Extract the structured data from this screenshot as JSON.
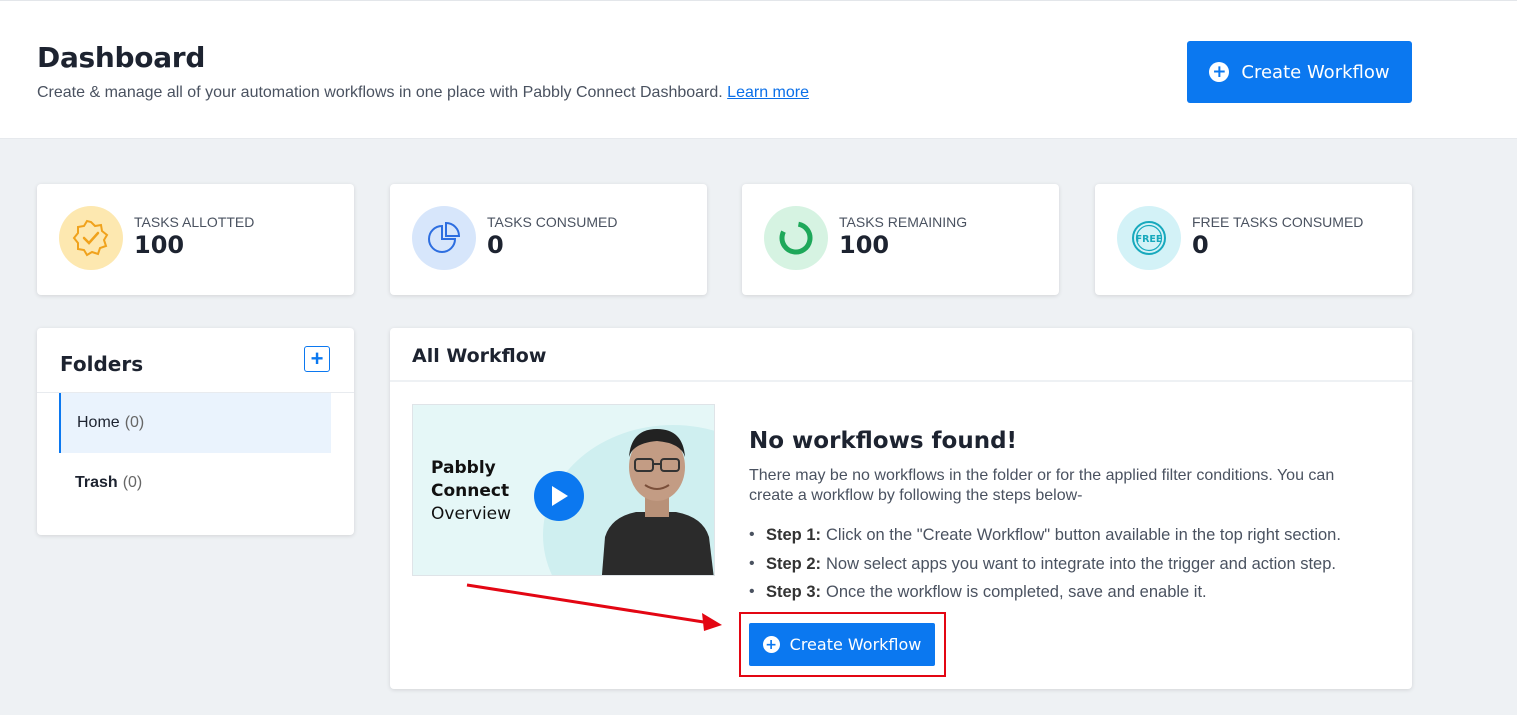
{
  "header": {
    "title": "Dashboard",
    "subtitle": "Create & manage all of your automation workflows in one place with Pabbly Connect Dashboard.",
    "learn_more": "Learn more",
    "create_button": "Create Workflow"
  },
  "stats": [
    {
      "label": "TASKS ALLOTTED",
      "value": "100",
      "icon": "badge-check-icon",
      "color": "#fde8b0"
    },
    {
      "label": "TASKS CONSUMED",
      "value": "0",
      "icon": "pie-chart-icon",
      "color": "#d7e6fb"
    },
    {
      "label": "TASKS REMAINING",
      "value": "100",
      "icon": "progress-ring-icon",
      "color": "#d6f3e2"
    },
    {
      "label": "FREE TASKS CONSUMED",
      "value": "0",
      "icon": "free-badge-icon",
      "color": "#d3f2f7"
    }
  ],
  "folders": {
    "title": "Folders",
    "items": [
      {
        "name": "Home",
        "count": "(0)"
      },
      {
        "name": "Trash",
        "count": "(0)"
      }
    ]
  },
  "workflows": {
    "title": "All Workflow",
    "video": {
      "line1": "Pabbly",
      "line2": "Connect",
      "line3": "Overview"
    },
    "empty_title": "No workflows found!",
    "empty_desc": "There may be no workflows in the folder or for the applied filter conditions. You can create a workflow by following the steps below-",
    "steps": [
      {
        "name": "Step 1:",
        "text": "Click on the \"Create Workflow\" button available in the top right section."
      },
      {
        "name": "Step 2:",
        "text": "Now select apps you want to integrate into the trigger and action step."
      },
      {
        "name": "Step 3:",
        "text": "Once the workflow is completed, save and enable it."
      }
    ],
    "create_button": "Create Workflow"
  },
  "colors": {
    "accent": "#0b78f0",
    "highlight": "#e30613"
  }
}
